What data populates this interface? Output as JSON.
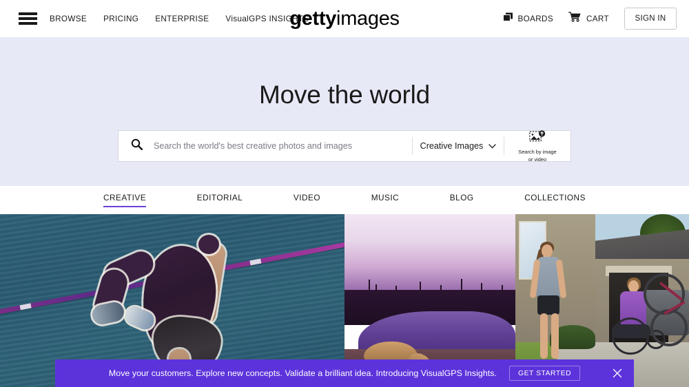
{
  "header": {
    "menu_icon": "hamburger-icon",
    "nav": [
      {
        "label": "BROWSE"
      },
      {
        "label": "PRICING"
      },
      {
        "label": "ENTERPRISE"
      },
      {
        "label": "VisualGPS INSIGHTS"
      }
    ],
    "logo": {
      "bold": "getty",
      "light": "images"
    },
    "boards": {
      "label": "BOARDS",
      "icon": "boards-icon"
    },
    "cart": {
      "label": "CART",
      "icon": "cart-icon"
    },
    "signin": {
      "label": "SIGN IN"
    }
  },
  "hero": {
    "title": "Move the world",
    "background_color": "#e7e9f7",
    "search": {
      "icon": "search-icon",
      "placeholder": "Search the world's best creative photos and images",
      "value": "",
      "filter_label": "Creative Images",
      "filter_icon": "chevron-down-icon",
      "visual_search": {
        "icon": "image-upload-icon",
        "line1": "Search by image",
        "line2": "or video"
      }
    }
  },
  "categories": {
    "active": "CREATIVE",
    "accent_color": "#6a40d8",
    "items": [
      {
        "label": "CREATIVE"
      },
      {
        "label": "EDITORIAL"
      },
      {
        "label": "VIDEO"
      },
      {
        "label": "MUSIC"
      },
      {
        "label": "BLOG"
      },
      {
        "label": "COLLECTIONS"
      }
    ]
  },
  "gallery": {
    "tiles": [
      {
        "alt": "High jumper arching backwards over a bar on a blue track"
      },
      {
        "alt": "Lioness drinking from a purple waterhole at dusk"
      },
      {
        "alt": "Two women talking outside a house, one using a wheelchair, beside a car bike rack"
      }
    ]
  },
  "banner": {
    "text": "Move your customers. Explore new concepts. Validate a brilliant idea. Introducing VisualGPS Insights.",
    "cta_label": "GET STARTED",
    "close_icon": "close-icon",
    "background_color": "#5c33db"
  }
}
